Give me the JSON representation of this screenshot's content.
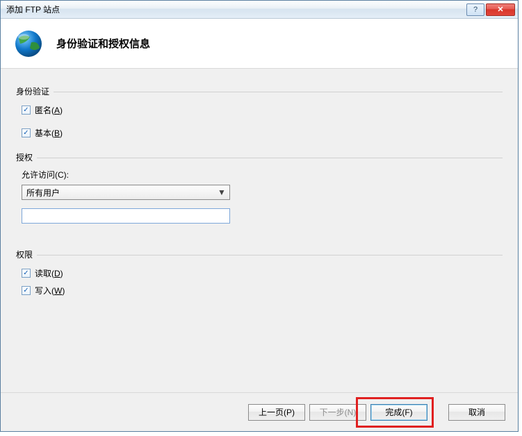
{
  "window": {
    "title": "添加 FTP 站点"
  },
  "header": {
    "title": "身份验证和授权信息"
  },
  "auth_group": {
    "label": "身份验证",
    "anonymous": {
      "label_pre": "匿名(",
      "hotkey": "A",
      "label_post": ")",
      "checked": true
    },
    "basic": {
      "label_pre": "基本(",
      "hotkey": "B",
      "label_post": ")",
      "checked": true
    }
  },
  "authz_group": {
    "label": "授权",
    "allow_access_label": "允许访问(C):",
    "selected_option": "所有用户",
    "filter_value": ""
  },
  "perm_group": {
    "label": "权限",
    "read": {
      "label_pre": "读取(",
      "hotkey": "D",
      "label_post": ")",
      "checked": true
    },
    "write": {
      "label_pre": "写入(",
      "hotkey": "W",
      "label_post": ")",
      "checked": true
    }
  },
  "footer": {
    "prev": "上一页(P)",
    "next": "下一步(N)",
    "finish": "完成(F)",
    "cancel": "取消"
  }
}
